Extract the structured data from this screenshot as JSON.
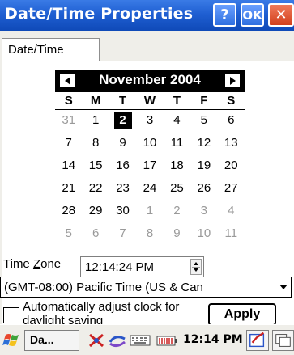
{
  "window": {
    "title": "Date/Time Properties",
    "help_label": "?",
    "ok_label": "OK",
    "close_label": "✕"
  },
  "tabs": [
    {
      "label": "Date/Time",
      "active": true
    }
  ],
  "calendar": {
    "month_year": "November 2004",
    "weekdays": [
      "S",
      "M",
      "T",
      "W",
      "T",
      "F",
      "S"
    ],
    "selected_day": "2",
    "weeks": [
      [
        "31",
        "1",
        "2",
        "3",
        "4",
        "5",
        "6"
      ],
      [
        "7",
        "8",
        "9",
        "10",
        "11",
        "12",
        "13"
      ],
      [
        "14",
        "15",
        "16",
        "17",
        "18",
        "19",
        "20"
      ],
      [
        "21",
        "22",
        "23",
        "24",
        "25",
        "26",
        "27"
      ],
      [
        "28",
        "29",
        "30",
        "1",
        "2",
        "3",
        "4"
      ],
      [
        "5",
        "6",
        "7",
        "8",
        "9",
        "10",
        "11"
      ]
    ],
    "other_month_mask": [
      [
        true,
        false,
        false,
        false,
        false,
        false,
        false
      ],
      [
        false,
        false,
        false,
        false,
        false,
        false,
        false
      ],
      [
        false,
        false,
        false,
        false,
        false,
        false,
        false
      ],
      [
        false,
        false,
        false,
        false,
        false,
        false,
        false
      ],
      [
        false,
        false,
        false,
        true,
        true,
        true,
        true
      ],
      [
        true,
        true,
        true,
        true,
        true,
        true,
        true
      ]
    ]
  },
  "time": {
    "value": "12:14:24 PM"
  },
  "timezone": {
    "label_pre": "Time ",
    "label_accel": "Z",
    "label_post": "one",
    "selected": "(GMT-08:00) Pacific Time (US & Can"
  },
  "dst": {
    "checked": false,
    "label": "Automatically adjust clock for daylight saving"
  },
  "apply": {
    "accel": "A",
    "rest": "pply"
  },
  "taskbar": {
    "task_label": "Da...",
    "clock": "12:14 PM"
  },
  "colors": {
    "titlebar": "#1f5fd2",
    "close_button": "#d2401c",
    "face": "#efeee9"
  }
}
